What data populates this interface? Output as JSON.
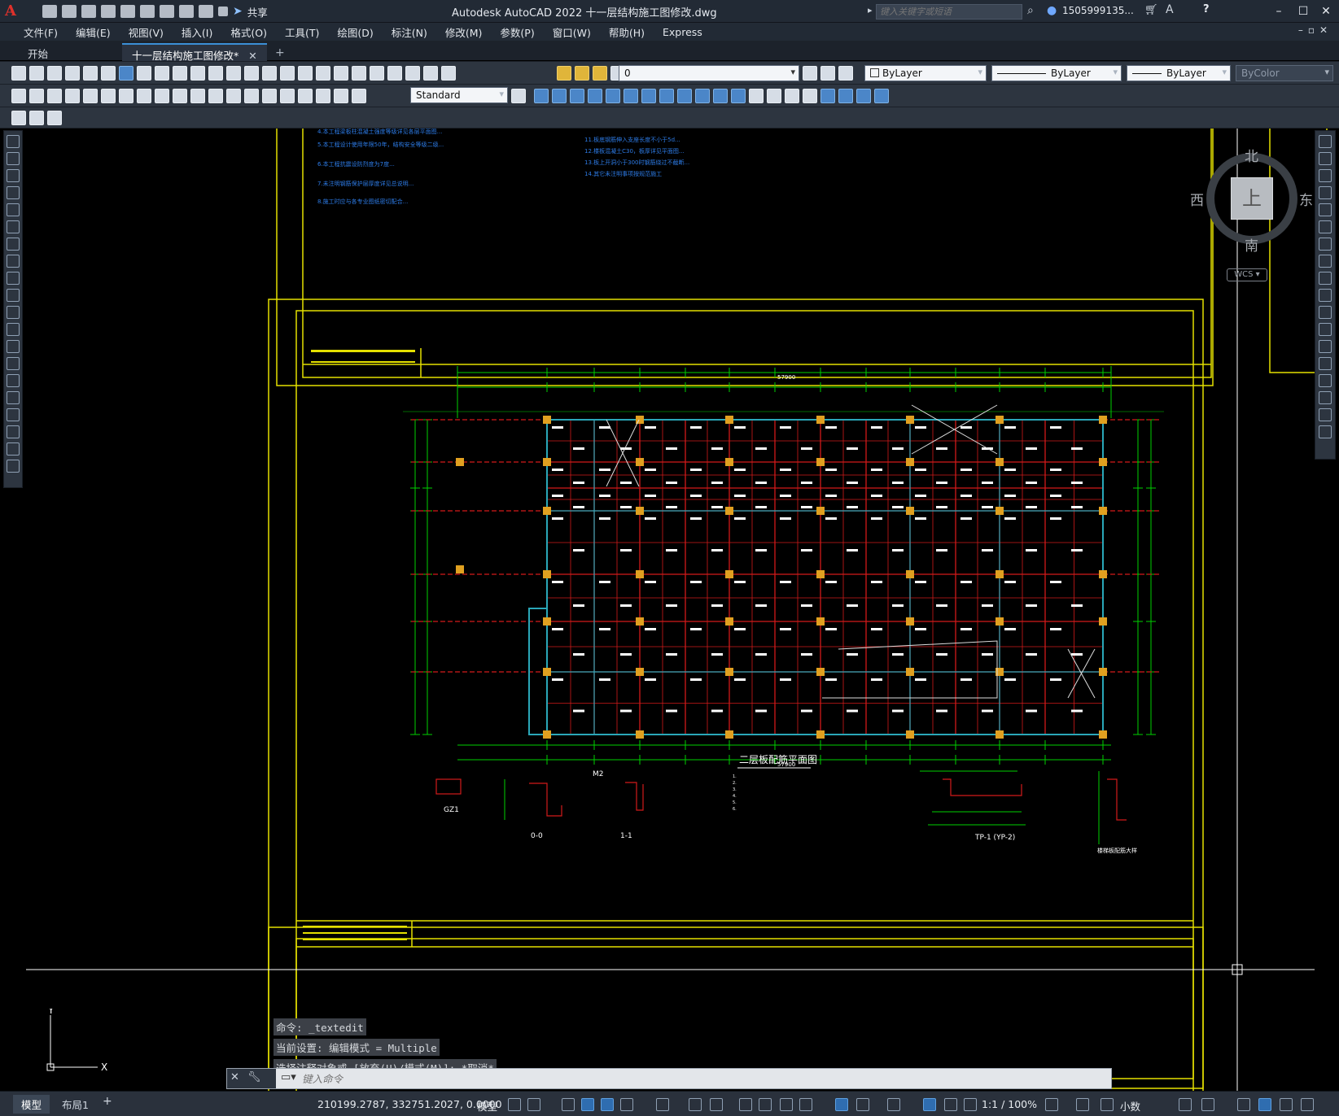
{
  "app": {
    "logo": "A",
    "title": "Autodesk AutoCAD 2022    十一层结构施工图修改.dwg",
    "share_label": "共享",
    "search_placeholder": "键入关键字或短语",
    "user": "1505999135...",
    "help": "?"
  },
  "menu": [
    "文件(F)",
    "编辑(E)",
    "视图(V)",
    "插入(I)",
    "格式(O)",
    "工具(T)",
    "绘图(D)",
    "标注(N)",
    "修改(M)",
    "参数(P)",
    "窗口(W)",
    "帮助(H)",
    "Express"
  ],
  "tabs": {
    "start": "开始",
    "drawing": "十一层结构施工图修改*",
    "close": "✕",
    "add": "+"
  },
  "toolbar": {
    "layer_value": "0",
    "color_value": "ByLayer",
    "linetype_value": "ByLayer",
    "lineweight_value": "ByLayer",
    "plotstyle_value": "ByColor",
    "textstyle_value": "Standard"
  },
  "viewcube": {
    "north": "北",
    "south": "南",
    "east": "东",
    "west": "西",
    "face": "上",
    "wcs": "WCS"
  },
  "drawing": {
    "plan_title": "二层板配筋平面图",
    "dim_total_top": "57900",
    "dim_total_bottom": "57900",
    "section_labels": [
      "GZ1",
      "0-0",
      "M2",
      "1-1",
      "TP-1 (YP-2)",
      "楼梯板配筋大样"
    ],
    "notes": [
      "4.本工程梁板柱混凝土强度等级详见各层平面图...",
      "5.本工程设计使用年限50年，结构安全等级二级...",
      "6.本工程抗震设防烈度为7度...",
      "7.未注明钢筋保护层厚度详见总说明...",
      "8.施工时应与各专业图纸密切配合..."
    ],
    "notes_right": [
      "11.板底钢筋伸入支座长度不小于5d...",
      "12.楼板混凝土C30，板厚详见平面图...",
      "13.板上开洞小于300时钢筋绕过不截断...",
      "14.其它未注明事项按规范施工"
    ]
  },
  "command": {
    "history": [
      "命令: _textedit",
      "当前设置: 编辑模式 = Multiple",
      "选择注释对象或 [放弃(U)/模式(M)]: *取消*"
    ],
    "input_placeholder": "键入命令"
  },
  "status": {
    "model_tab": "模型",
    "layout_tab": "布局1",
    "add_tab": "+",
    "coords": "210199.2787, 332751.2027, 0.0000",
    "space": "模型",
    "scale": "1:1 / 100%",
    "units": "小数"
  },
  "colors": {
    "frame": "#e4e000",
    "grid_green": "#00d000",
    "beam_red": "#d21a1a",
    "column_orange": "#e0a020",
    "wall_cyan": "#2aa7b8",
    "canvas": "#000000"
  }
}
